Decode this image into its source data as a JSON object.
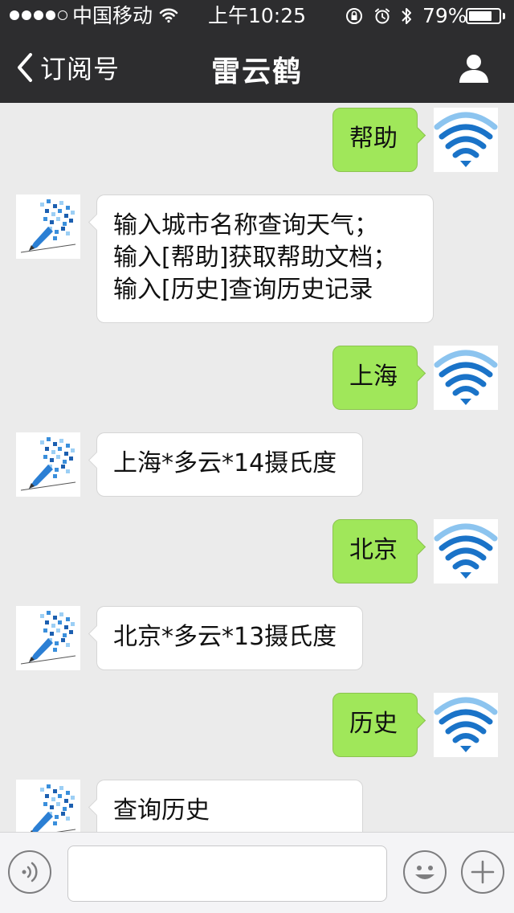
{
  "status_bar": {
    "signal_dots_filled": 4,
    "signal_dots_total": 5,
    "carrier": "中国移动",
    "time": "上午10:25",
    "battery_percent": "79%",
    "battery_level": 0.79
  },
  "nav": {
    "back_label": "订阅号",
    "title": "雷云鹤"
  },
  "messages": [
    {
      "side": "right",
      "lines": [
        "帮助"
      ],
      "avatar": "wifi-avatar"
    },
    {
      "side": "left",
      "lines": [
        "输入城市名称查询天气；",
        "输入[帮助]获取帮助文档；",
        "输入[历史]查询历史记录"
      ],
      "avatar": "pencil-avatar"
    },
    {
      "side": "right",
      "lines": [
        "上海"
      ],
      "avatar": "wifi-avatar"
    },
    {
      "side": "left",
      "lines": [
        "上海*多云*14摄氏度"
      ],
      "avatar": "pencil-avatar"
    },
    {
      "side": "right",
      "lines": [
        "北京"
      ],
      "avatar": "wifi-avatar"
    },
    {
      "side": "left",
      "lines": [
        "北京*多云*13摄氏度"
      ],
      "avatar": "pencil-avatar"
    },
    {
      "side": "right",
      "lines": [
        "历史"
      ],
      "avatar": "wifi-avatar"
    },
    {
      "side": "left",
      "lines": [
        "查询历史"
      ],
      "avatar": "pencil-avatar"
    }
  ],
  "input": {
    "value": "",
    "placeholder": ""
  },
  "colors": {
    "navbar_bg": "#2d2d2f",
    "chat_bg": "#ebebeb",
    "outgoing_bubble": "#a0e75a",
    "incoming_bubble": "#ffffff",
    "wifi_blue": "#1a73c8"
  },
  "icons": {
    "back": "chevron-left-icon",
    "profile": "person-icon",
    "voice": "voice-icon",
    "emoji": "smiley-icon",
    "more": "plus-icon"
  }
}
